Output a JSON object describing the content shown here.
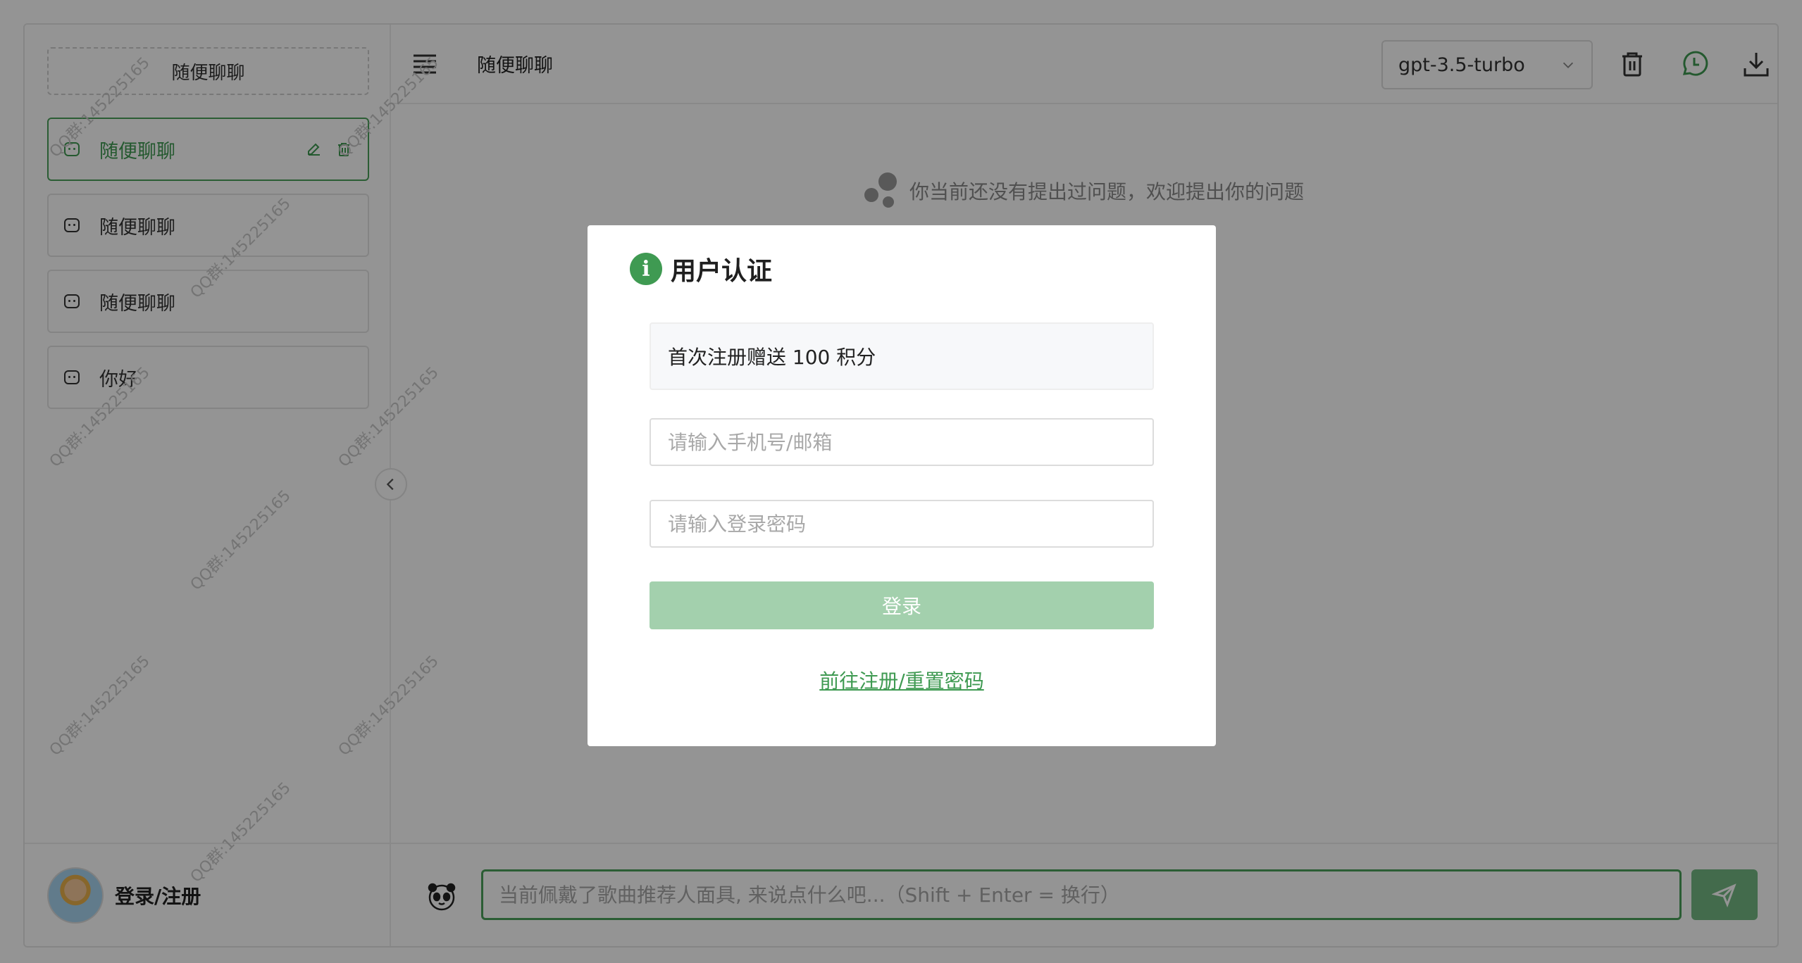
{
  "sidebar": {
    "new_chat_label": "随便聊聊",
    "items": [
      {
        "label": "随便聊聊"
      },
      {
        "label": "随便聊聊"
      },
      {
        "label": "随便聊聊"
      },
      {
        "label": "你好"
      }
    ],
    "login_label": "登录/注册"
  },
  "topbar": {
    "title": "随便聊聊",
    "model": "gpt-3.5-turbo"
  },
  "main": {
    "empty_hint": "你当前还没有提出过问题，欢迎提出你的问题",
    "input_placeholder": "当前佩戴了歌曲推荐人面具, 来说点什么吧...（Shift + Enter = 换行）"
  },
  "modal": {
    "title": "用户认证",
    "notice": "首次注册赠送 100 积分",
    "account_placeholder": "请输入手机号/邮箱",
    "password_placeholder": "请输入登录密码",
    "login_button": "登录",
    "register_link": "前往注册/重置密码"
  },
  "watermark": "QQ群:145225165",
  "colors": {
    "accent": "#3f9a52",
    "accent_light": "#a3d0ad",
    "overlay": "rgba(0,0,0,0.42)"
  }
}
